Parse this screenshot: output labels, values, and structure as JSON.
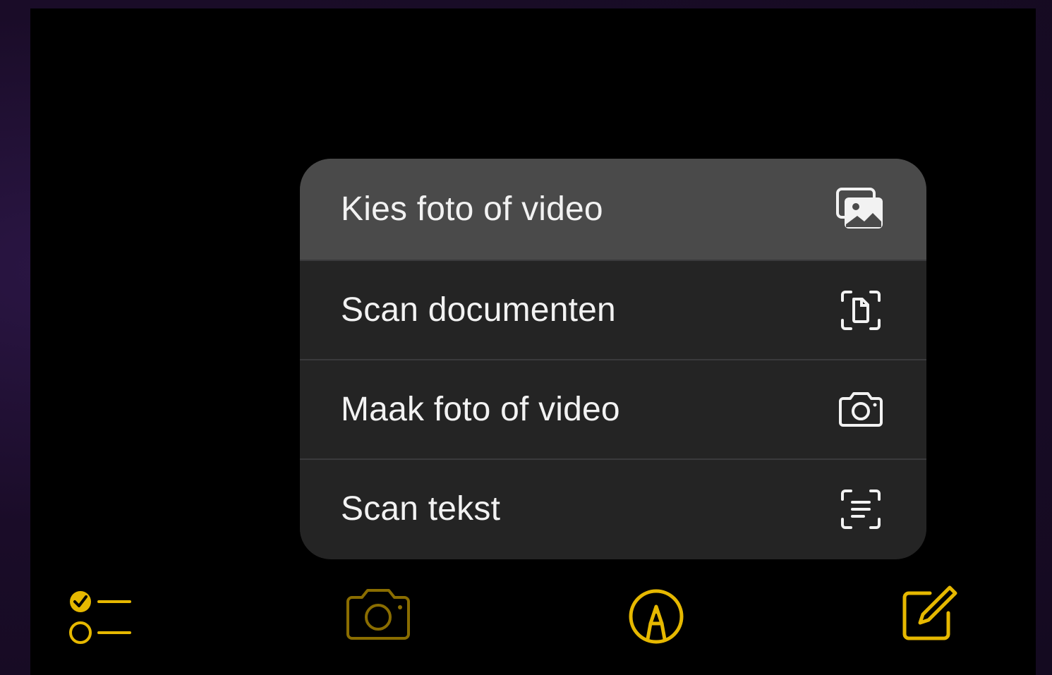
{
  "colors": {
    "accent": "#e6b800",
    "menu_background": "#242424",
    "menu_highlight": "#4a4a4a",
    "separator": "#3a3a3c",
    "text": "#f2f2f2"
  },
  "menu": {
    "items": [
      {
        "label": "Kies foto of video",
        "icon": "photo-library-icon",
        "highlighted": true
      },
      {
        "label": "Scan documenten",
        "icon": "scan-document-icon",
        "highlighted": false
      },
      {
        "label": "Maak foto of video",
        "icon": "camera-icon",
        "highlighted": false
      },
      {
        "label": "Scan tekst",
        "icon": "scan-text-icon",
        "highlighted": false
      }
    ]
  },
  "toolbar": {
    "items": [
      {
        "icon": "checklist-icon"
      },
      {
        "icon": "camera-icon"
      },
      {
        "icon": "markup-pen-icon"
      },
      {
        "icon": "compose-icon"
      }
    ]
  }
}
